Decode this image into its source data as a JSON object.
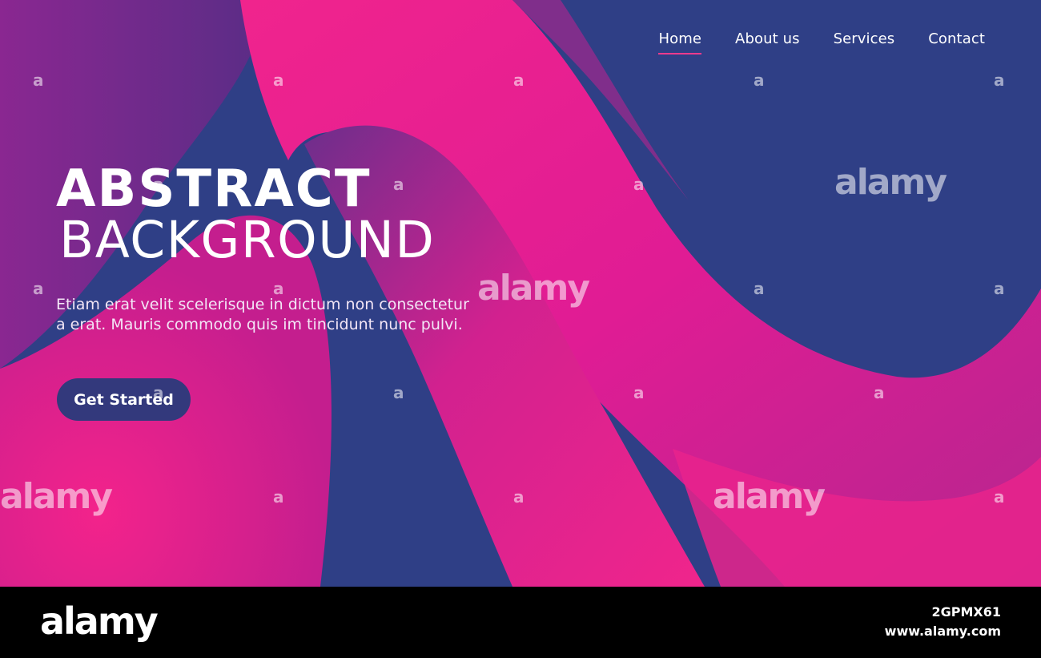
{
  "nav": {
    "items": [
      {
        "label": "Home",
        "active": true
      },
      {
        "label": "About us",
        "active": false
      },
      {
        "label": "Services",
        "active": false
      },
      {
        "label": "Contact",
        "active": false
      }
    ]
  },
  "hero": {
    "title_line1": "ABSTRACT",
    "title_line2": "BACKGROUND",
    "description": "Etiam erat velit scelerisque in dictum non consectetur a erat. Mauris commodo quis im tincidunt nunc pulvi.",
    "cta_label": "Get Started"
  },
  "watermark": {
    "big": "alamy",
    "small": "a"
  },
  "footer": {
    "logo": "alamy",
    "image_id": "2GPMX61",
    "url": "www.alamy.com"
  },
  "colors": {
    "background_blue": "#2f3f86",
    "magenta": "#e91e8c",
    "purple": "#7a2a8f",
    "button": "#33397c",
    "nav_underline": "#ec3a8d"
  }
}
